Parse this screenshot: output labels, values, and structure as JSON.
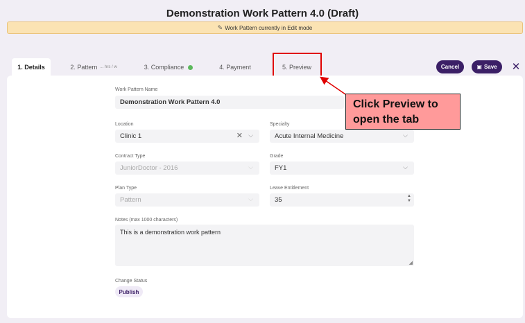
{
  "header": {
    "title": "Demonstration Work Pattern 4.0 (Draft)",
    "edit_banner": "Work Pattern currently in Edit mode"
  },
  "tabs": [
    {
      "label": "1. Details",
      "active": true
    },
    {
      "label": "2. Pattern",
      "hint": "... hrs / w"
    },
    {
      "label": "3. Compliance",
      "status": "complete"
    },
    {
      "label": "4. Payment"
    },
    {
      "label": "5. Preview"
    }
  ],
  "actions": {
    "cancel_label": "Cancel",
    "save_label": "Save",
    "close_icon": "close-icon"
  },
  "form": {
    "name": {
      "label": "Work Pattern Name",
      "value": "Demonstration Work Pattern 4.0"
    },
    "location": {
      "label": "Location",
      "value": "Clinic 1"
    },
    "specialty": {
      "label": "Specialty",
      "value": "Acute Internal Medicine"
    },
    "contract_type": {
      "label": "Contract Type",
      "value": "JuniorDoctor - 2016"
    },
    "grade": {
      "label": "Grade",
      "value": "FY1"
    },
    "plan_type": {
      "label": "Plan Type",
      "value": "Pattern"
    },
    "leave": {
      "label": "Leave Entitlement",
      "value": "35"
    },
    "notes": {
      "label": "Notes (max 1000 characters)",
      "value": "This is a demonstration work pattern"
    },
    "change_status": {
      "label": "Change Status",
      "value": "Publish"
    }
  },
  "annotation": {
    "line1": "Click Preview to",
    "line2": "open the tab",
    "highlight_color": "#e00000",
    "callout_color": "#ff9a9a"
  },
  "colors": {
    "brand": "#3b1f66",
    "banner": "#fbe3b3",
    "check": "#5cb85c"
  }
}
